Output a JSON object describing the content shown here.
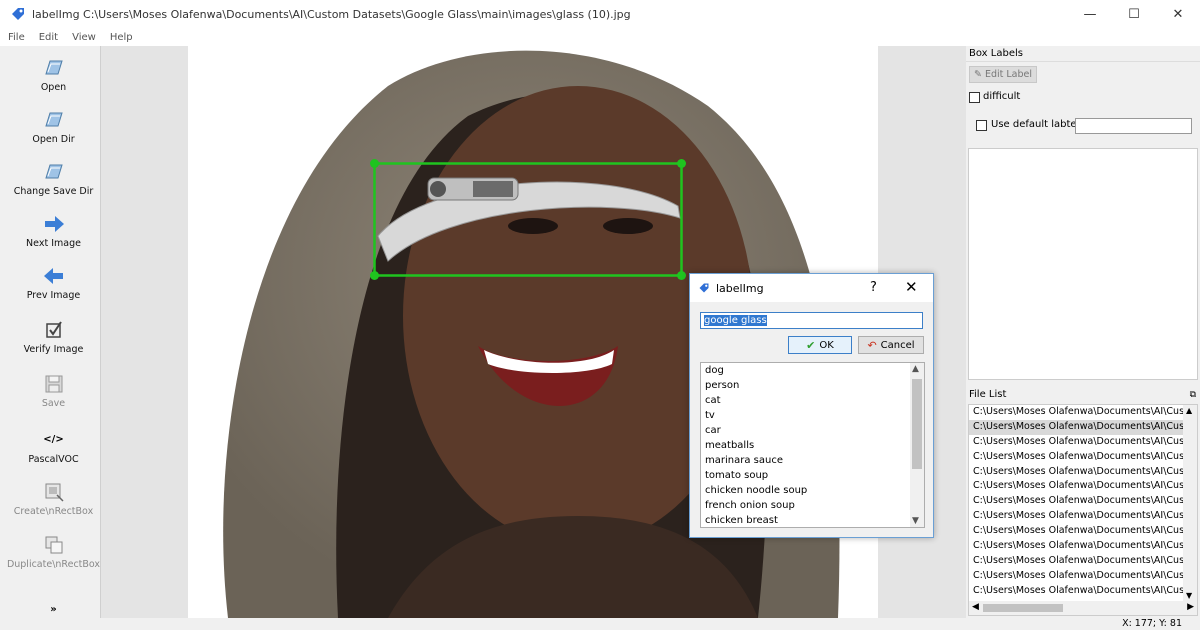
{
  "window": {
    "title": "labelImg C:\\Users\\Moses Olafenwa\\Documents\\AI\\Custom Datasets\\Google Glass\\main\\images\\glass (10).jpg",
    "minimize": "—",
    "maximize": "☐",
    "close": "✕"
  },
  "menu": [
    "File",
    "Edit",
    "View",
    "Help"
  ],
  "toolbar": {
    "open": "Open",
    "open_dir": "Open Dir",
    "change_save_dir": "Change Save Dir",
    "next_image": "Next Image",
    "prev_image": "Prev Image",
    "verify_image": "Verify Image",
    "save": "Save",
    "format_icon": "</>",
    "format": "PascalVOC",
    "create_rectbox": "Create\\nRectBox",
    "duplicate_rectbox": "Duplicate\\nRectBox",
    "more": "»"
  },
  "colors": {
    "bbox": "#1fc41f",
    "selection": "#3078d0"
  },
  "dialog": {
    "title": "labelImg",
    "help": "?",
    "close": "✕",
    "input_value": "google glass",
    "ok": "OK",
    "cancel": "Cancel",
    "labels": [
      "dog",
      "person",
      "cat",
      "tv",
      "car",
      "meatballs",
      "marinara sauce",
      "tomato soup",
      "chicken noodle soup",
      "french onion soup",
      "chicken breast"
    ]
  },
  "right_panel": {
    "box_labels_title": "Box Labels",
    "edit_label": "Edit Label",
    "difficult": "difficult",
    "use_default_label": "Use default labtel",
    "file_list_title": "File List",
    "files": [
      "C:\\Users\\Moses Olafenwa\\Documents\\AI\\Cus",
      "C:\\Users\\Moses Olafenwa\\Documents\\AI\\Cus",
      "C:\\Users\\Moses Olafenwa\\Documents\\AI\\Cus",
      "C:\\Users\\Moses Olafenwa\\Documents\\AI\\Cus",
      "C:\\Users\\Moses Olafenwa\\Documents\\AI\\Cus",
      "C:\\Users\\Moses Olafenwa\\Documents\\AI\\Cus",
      "C:\\Users\\Moses Olafenwa\\Documents\\AI\\Cus",
      "C:\\Users\\Moses Olafenwa\\Documents\\AI\\Cus",
      "C:\\Users\\Moses Olafenwa\\Documents\\AI\\Cus",
      "C:\\Users\\Moses Olafenwa\\Documents\\AI\\Cus",
      "C:\\Users\\Moses Olafenwa\\Documents\\AI\\Cus",
      "C:\\Users\\Moses Olafenwa\\Documents\\AI\\Cus",
      "C:\\Users\\Moses Olafenwa\\Documents\\AI\\Cus"
    ]
  },
  "status": "X: 177; Y: 81"
}
